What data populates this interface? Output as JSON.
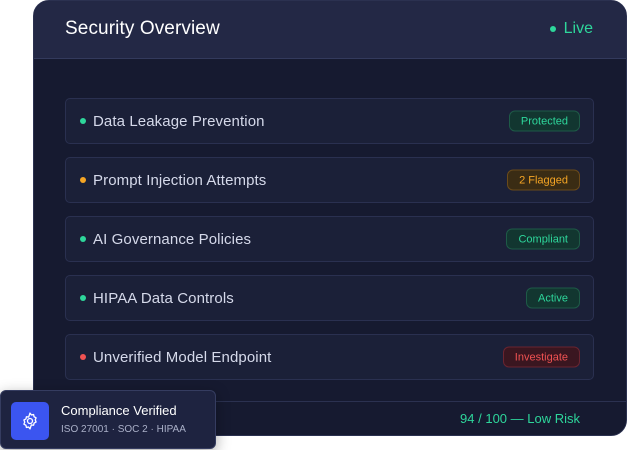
{
  "panel": {
    "title": "Security Overview",
    "status": "Live",
    "status_color": "#2ed69b"
  },
  "items": [
    {
      "label": "Data Leakage Prevention",
      "status": "Protected",
      "tone": "green",
      "dot_color": "#2ed69b"
    },
    {
      "label": "Prompt Injection Attempts",
      "status": "2 Flagged",
      "tone": "amber",
      "dot_color": "#f5a524"
    },
    {
      "label": "AI Governance Policies",
      "status": "Compliant",
      "tone": "green",
      "dot_color": "#2ed69b"
    },
    {
      "label": "HIPAA Data Controls",
      "status": "Active",
      "tone": "green",
      "dot_color": "#2ed69b"
    },
    {
      "label": "Unverified Model Endpoint",
      "status": "Investigate",
      "tone": "red",
      "dot_color": "#f05252"
    }
  ],
  "footer": {
    "risk": "94 / 100 — Low Risk"
  },
  "compliance": {
    "title": "Compliance Verified",
    "standards": "ISO 27001 · SOC 2 · HIPAA",
    "icon": "gear-shield-icon",
    "accent": "#3b55f0"
  }
}
